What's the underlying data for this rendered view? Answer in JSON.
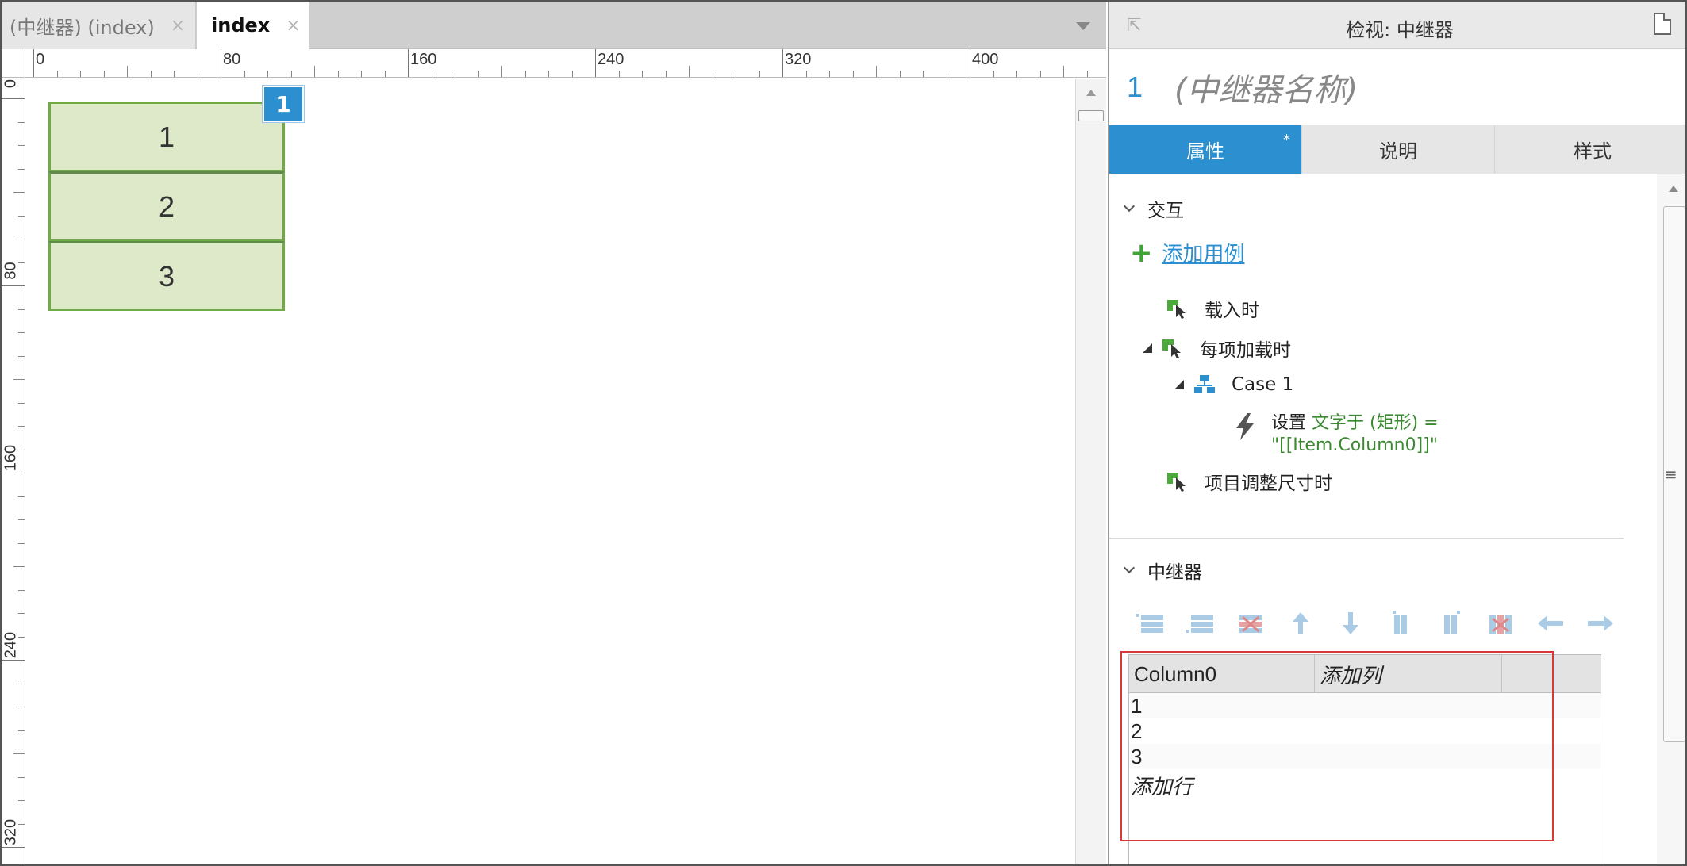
{
  "editor": {
    "tabs": [
      {
        "label": "(中继器) (index)",
        "active": false
      },
      {
        "label": "index",
        "active": true
      }
    ],
    "tab_close_glyph": "×",
    "hruler_labels": [
      "0",
      "80",
      "160",
      "240",
      "320",
      "400"
    ],
    "vruler_labels": [
      "0",
      "80",
      "160",
      "240",
      "320"
    ],
    "repeater_items": [
      "1",
      "2",
      "3"
    ],
    "repeater_badge": "1",
    "colors": {
      "item_fill": "#dde9c9",
      "item_border": "#6faa46",
      "badge": "#2b8fd0"
    }
  },
  "inspector": {
    "title": "检视: 中继器",
    "widget_number": "1",
    "widget_name": "(中继器名称)",
    "tabs": [
      {
        "label": "属性",
        "active": true,
        "modified": "*"
      },
      {
        "label": "说明",
        "active": false
      },
      {
        "label": "样式",
        "active": false
      }
    ],
    "interactions": {
      "heading": "交互",
      "add_case": "添加用例",
      "events": [
        {
          "label": "载入时"
        },
        {
          "label": "每项加载时"
        },
        {
          "label": "项目调整尺寸时"
        }
      ],
      "case_label": "Case 1",
      "action": {
        "verb": "设置",
        "target": "文字于 (矩形) =",
        "expression": "\"[[Item.Column0]]\""
      }
    },
    "repeater": {
      "heading": "中继器",
      "toolbar_icons": [
        "insert-row-above-icon",
        "insert-row-below-icon",
        "delete-row-icon",
        "move-up-icon",
        "move-down-icon",
        "insert-column-left-icon",
        "insert-column-right-icon",
        "delete-column-icon",
        "move-left-icon",
        "move-right-icon"
      ],
      "columns": [
        "Column0"
      ],
      "add_column": "添加列",
      "rows": [
        "1",
        "2",
        "3"
      ],
      "add_row": "添加行"
    },
    "colors": {
      "accent": "#2b8fd0",
      "link": "#2b8fd0",
      "green": "#3a8a2f",
      "highlight": "#d9383b"
    }
  }
}
